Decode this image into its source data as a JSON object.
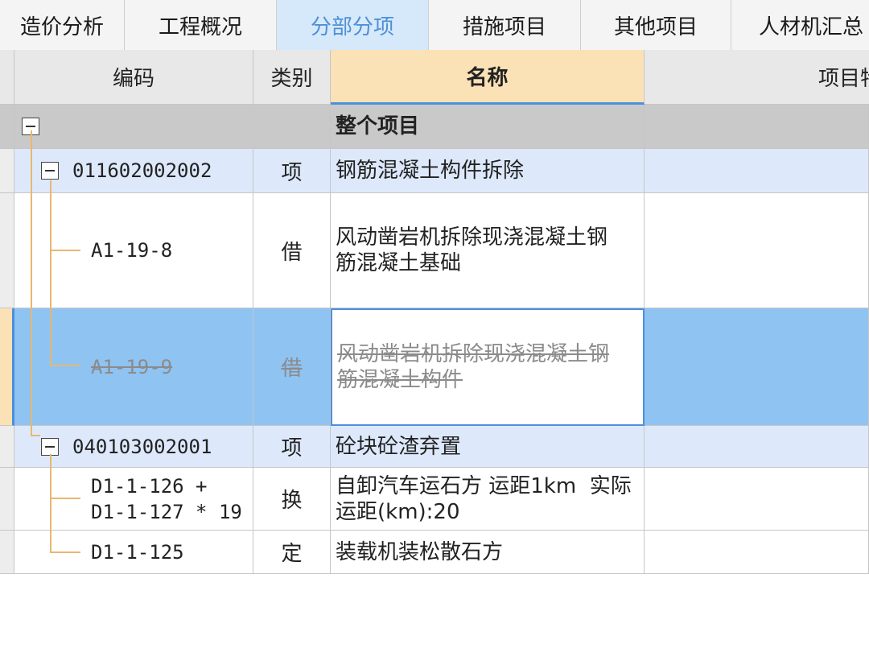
{
  "tabs": [
    "造价分析",
    "工程概况",
    "分部分项",
    "措施项目",
    "其他项目",
    "人材机汇总"
  ],
  "active_tab": "分部分项",
  "columns": {
    "code": "编码",
    "type": "类别",
    "name": "名称",
    "feature": "项目特征"
  },
  "rows": [
    {
      "code": "",
      "type": "",
      "name": "整个项目"
    },
    {
      "code": "011602002002",
      "type": "项",
      "name": "钢筋混凝土构件拆除"
    },
    {
      "code": "A1-19-8",
      "type": "借",
      "name": "风动凿岩机拆除现浇混凝土钢筋混凝土基础"
    },
    {
      "code": "A1-19-9",
      "type": "借",
      "name": "风动凿岩机拆除现浇混凝土钢筋混凝土构件"
    },
    {
      "code": "040103002001",
      "type": "项",
      "name": "砼块砼渣弃置"
    },
    {
      "code": "D1-1-126 + D1-1-127 * 19",
      "type": "换",
      "name": "自卸汽车运石方 运距1km  实际运距(km):20"
    },
    {
      "code": "D1-1-125",
      "type": "定",
      "name": "装载机装松散石方"
    }
  ],
  "colors": {
    "active_tab_bg": "#d6e9fb",
    "selected_row": "#8fc3f2",
    "item_row": "#dde9fb",
    "header_sel": "#fbe1b6",
    "tree_line": "#e9b770"
  }
}
